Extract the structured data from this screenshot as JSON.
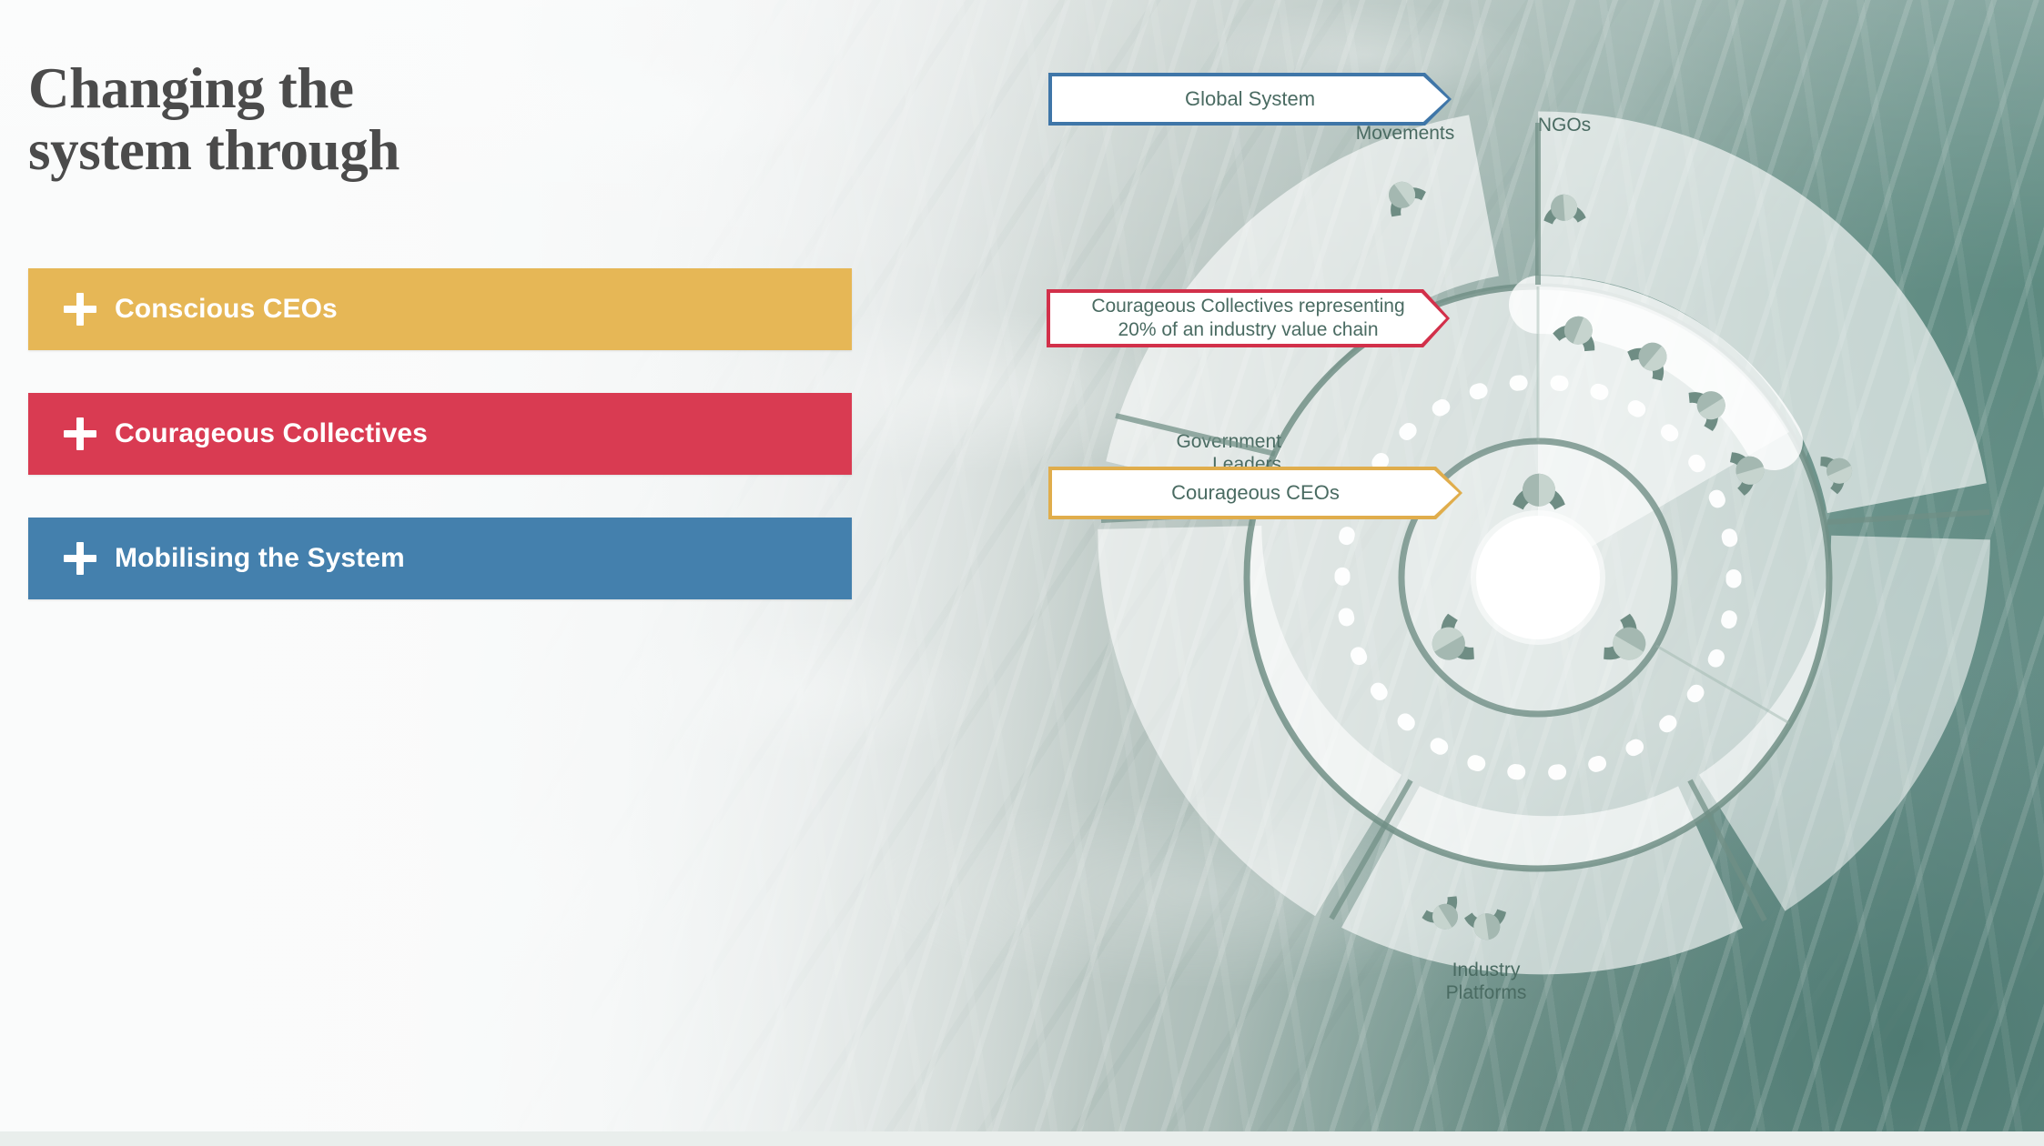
{
  "page": {
    "title": "Changing the\nsystem through"
  },
  "accordion": {
    "items": [
      {
        "id": "conscious-ceos",
        "label": "Conscious CEOs",
        "color": "#e6b756",
        "icon": "plus-icon"
      },
      {
        "id": "courageous-collectives",
        "label": "Courageous Collectives",
        "color": "#d93b52",
        "icon": "plus-icon"
      },
      {
        "id": "mobilising-the-system",
        "label": "Mobilising the System",
        "color": "#4480ad",
        "icon": "plus-icon"
      }
    ]
  },
  "callouts": [
    {
      "id": "global-system",
      "label": "Global System",
      "border_color": "#3f76a8",
      "text_color": "#4a6b62"
    },
    {
      "id": "courageous-collectives",
      "label": "Courageous Collectives representing\n20% of an industry value chain",
      "border_color": "#d2304a",
      "text_color": "#4a6b62"
    },
    {
      "id": "courageous-ceos",
      "label": "Courageous CEOs",
      "border_color": "#e0ad4c",
      "text_color": "#4a6b62"
    }
  ],
  "diagram": {
    "type": "radial-system-map",
    "center_label": "",
    "ring_colors": {
      "stroke": "#718f86",
      "segment_fill": "#ffffff",
      "dashed_ring": "#ffffff"
    },
    "outer_segments": [
      {
        "id": "youth-movements",
        "label": "Youth\nMovements",
        "icon": "person-icon"
      },
      {
        "id": "ngos",
        "label": "NGOs",
        "icon": "person-icon"
      },
      {
        "id": "government-leaders",
        "label": "Government\nLeaders",
        "icon": "person-icon"
      },
      {
        "id": "industry-platforms",
        "label": "Industry\nPlatforms",
        "icon": "person-icon"
      }
    ],
    "inner_people_count": 3,
    "collective_people_count": 4
  }
}
